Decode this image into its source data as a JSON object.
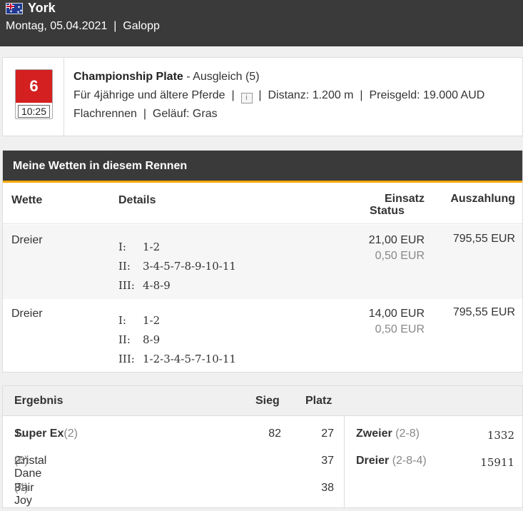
{
  "header": {
    "venue": "York",
    "date": "Montag, 05.04.2021",
    "separator": "|",
    "type": "Galopp",
    "flag_icon": "australia-flag-icon"
  },
  "race": {
    "number": "6",
    "time": "10:25",
    "name": "Championship Plate",
    "class": "- Ausgleich (5)",
    "conditions": "Für 4jährige und ältere Pferde",
    "info_icon_glyph": "i",
    "distance": "Distanz: 1.200 m",
    "prize": "Preisgeld: 19.000 AUD",
    "surface_type": "Flachrennen",
    "going": "Geläuf: Gras"
  },
  "bets": {
    "title": "Meine Wetten in diesem Rennen",
    "columns": {
      "bet": "Wette",
      "details": "Details",
      "stake": "Einsatz",
      "status": "Status",
      "payout": "Auszahlung"
    },
    "rows": [
      {
        "type": "Dreier",
        "legs": [
          {
            "label": "I:",
            "value": "1-2"
          },
          {
            "label": "II:",
            "value": "3-4-5-7-8-9-10-11"
          },
          {
            "label": "III:",
            "value": "4-8-9"
          }
        ],
        "stake": "21,00 EUR",
        "status": "0,50 EUR",
        "payout": "795,55 EUR"
      },
      {
        "type": "Dreier",
        "legs": [
          {
            "label": "I:",
            "value": "1-2"
          },
          {
            "label": "II:",
            "value": "8-9"
          },
          {
            "label": "III:",
            "value": "1-2-3-4-5-7-10-11"
          }
        ],
        "stake": "14,00 EUR",
        "status": "0,50 EUR",
        "payout": "795,55 EUR"
      }
    ]
  },
  "result": {
    "columns": {
      "title": "Ergebnis",
      "win": "Sieg",
      "place": "Platz"
    },
    "finishers": [
      {
        "pos": "1.",
        "horse": "Super Ex",
        "num": "(2)",
        "win": "82",
        "place": "27"
      },
      {
        "pos": "2.",
        "horse": "Cristal Dane",
        "num": "(8)",
        "win": "",
        "place": "37"
      },
      {
        "pos": "3.",
        "horse": "Fair Joy",
        "num": "(4)",
        "win": "",
        "place": "38"
      }
    ],
    "exotics": [
      {
        "name": "Zweier",
        "combo": "(2-8)",
        "amount": "1332"
      },
      {
        "name": "Dreier",
        "combo": "(2-8-4)",
        "amount": "15911"
      }
    ]
  }
}
